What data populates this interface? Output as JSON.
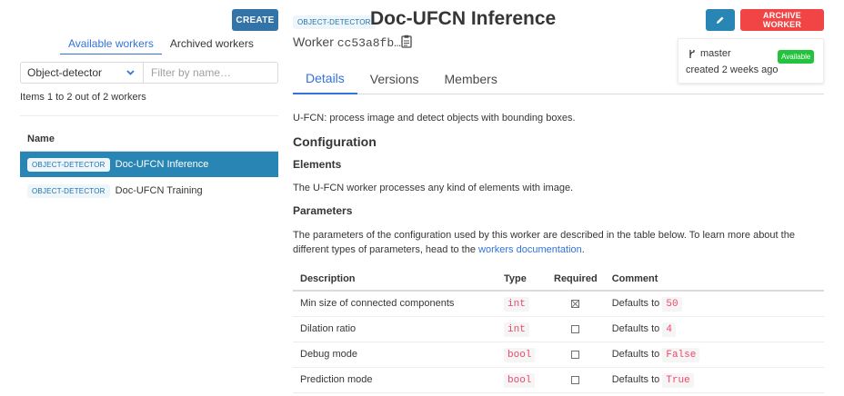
{
  "left_panel": {
    "create_label": "CREATE",
    "tabs": [
      {
        "label": "Available workers",
        "active": true
      },
      {
        "label": "Archived workers",
        "active": false
      }
    ],
    "type_filter": {
      "selected": "Object-detector"
    },
    "name_filter": {
      "placeholder": "Filter by name…",
      "value": ""
    },
    "items_count": "Items 1 to 2 out of 2 workers",
    "table_header": "Name",
    "workers": [
      {
        "tag": "OBJECT-DETECTOR",
        "name": "Doc-UFCN Inference",
        "selected": true
      },
      {
        "tag": "OBJECT-DETECTOR",
        "name": "Doc-UFCN Training",
        "selected": false
      }
    ]
  },
  "header": {
    "tag": "OBJECT-DETECTOR",
    "title": "Doc-UFCN Inference",
    "worker_prefix": "Worker",
    "worker_id": "cc53a8fb…",
    "archive_label": "ARCHIVE WORKER",
    "branch": "master",
    "created": "created 2 weeks ago",
    "status": "Available",
    "status_color": "#23c33d",
    "accent": "#3273dc",
    "archive_color": "#f14545"
  },
  "main_tabs": [
    {
      "label": "Details",
      "active": true
    },
    {
      "label": "Versions",
      "active": false
    },
    {
      "label": "Members",
      "active": false
    }
  ],
  "content": {
    "description": "U-FCN: process image and detect objects with bounding boxes.",
    "configuration_heading": "Configuration",
    "elements_heading": "Elements",
    "elements_text": "The U-FCN worker processes any kind of elements with image.",
    "parameters_heading": "Parameters",
    "parameters_text_before": "The parameters of the configuration used by this worker are described in the table below. To learn more about the different types of parameters, head to the ",
    "parameters_link": "workers documentation",
    "parameters_text_after": ".",
    "table": {
      "headers": {
        "description": "Description",
        "type": "Type",
        "required": "Required",
        "comment": "Comment"
      },
      "rows": [
        {
          "description": "Min size of connected components",
          "type": "int",
          "required": true,
          "comment_prefix": "Defaults to",
          "default": "50"
        },
        {
          "description": "Dilation ratio",
          "type": "int",
          "required": false,
          "comment_prefix": "Defaults to",
          "default": "4"
        },
        {
          "description": "Debug mode",
          "type": "bool",
          "required": false,
          "comment_prefix": "Defaults to",
          "default": "False"
        },
        {
          "description": "Prediction mode",
          "type": "bool",
          "required": false,
          "comment_prefix": "Defaults to",
          "default": "True"
        }
      ]
    }
  }
}
